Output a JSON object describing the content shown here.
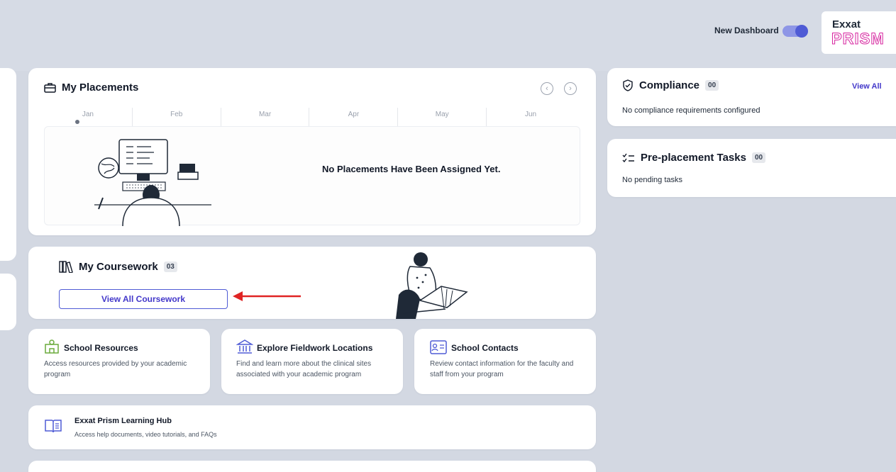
{
  "header": {
    "new_dashboard_label": "New Dashboard",
    "toggle_on": true,
    "logo_top": "Exxat",
    "logo_bottom": "PRISM"
  },
  "placements": {
    "title": "My Placements",
    "months": [
      "Jan",
      "Feb",
      "Mar",
      "Apr",
      "May",
      "Jun"
    ],
    "empty_message": "No Placements Have Been Assigned Yet.",
    "prev_icon": "chevron-left-icon",
    "next_icon": "chevron-right-icon"
  },
  "coursework": {
    "title": "My Coursework",
    "count": "03",
    "button_label": "View All Coursework"
  },
  "resources": [
    {
      "title": "School Resources",
      "desc": "Access resources provided by your academic program",
      "icon": "building-blocks-icon"
    },
    {
      "title": "Explore Fieldwork Locations",
      "desc": "Find and learn more about the clinical sites associated with your academic program",
      "icon": "institution-icon"
    },
    {
      "title": "School Contacts",
      "desc": "Review contact information for the faculty and staff from your program",
      "icon": "contact-card-icon"
    }
  ],
  "learning_hub": {
    "title": "Exxat Prism Learning Hub",
    "desc": "Access help documents, video tutorials, and FAQs"
  },
  "compliance": {
    "title": "Compliance",
    "count": "00",
    "view_all": "View All",
    "message": "No compliance requirements configured"
  },
  "preplacement": {
    "title": "Pre-placement Tasks",
    "count": "00",
    "message": "No pending tasks"
  },
  "colors": {
    "accent": "#4f5bd5",
    "background": "#d3d8e2",
    "annotation_arrow": "#e02424",
    "logo_pink": "#d6249f"
  }
}
